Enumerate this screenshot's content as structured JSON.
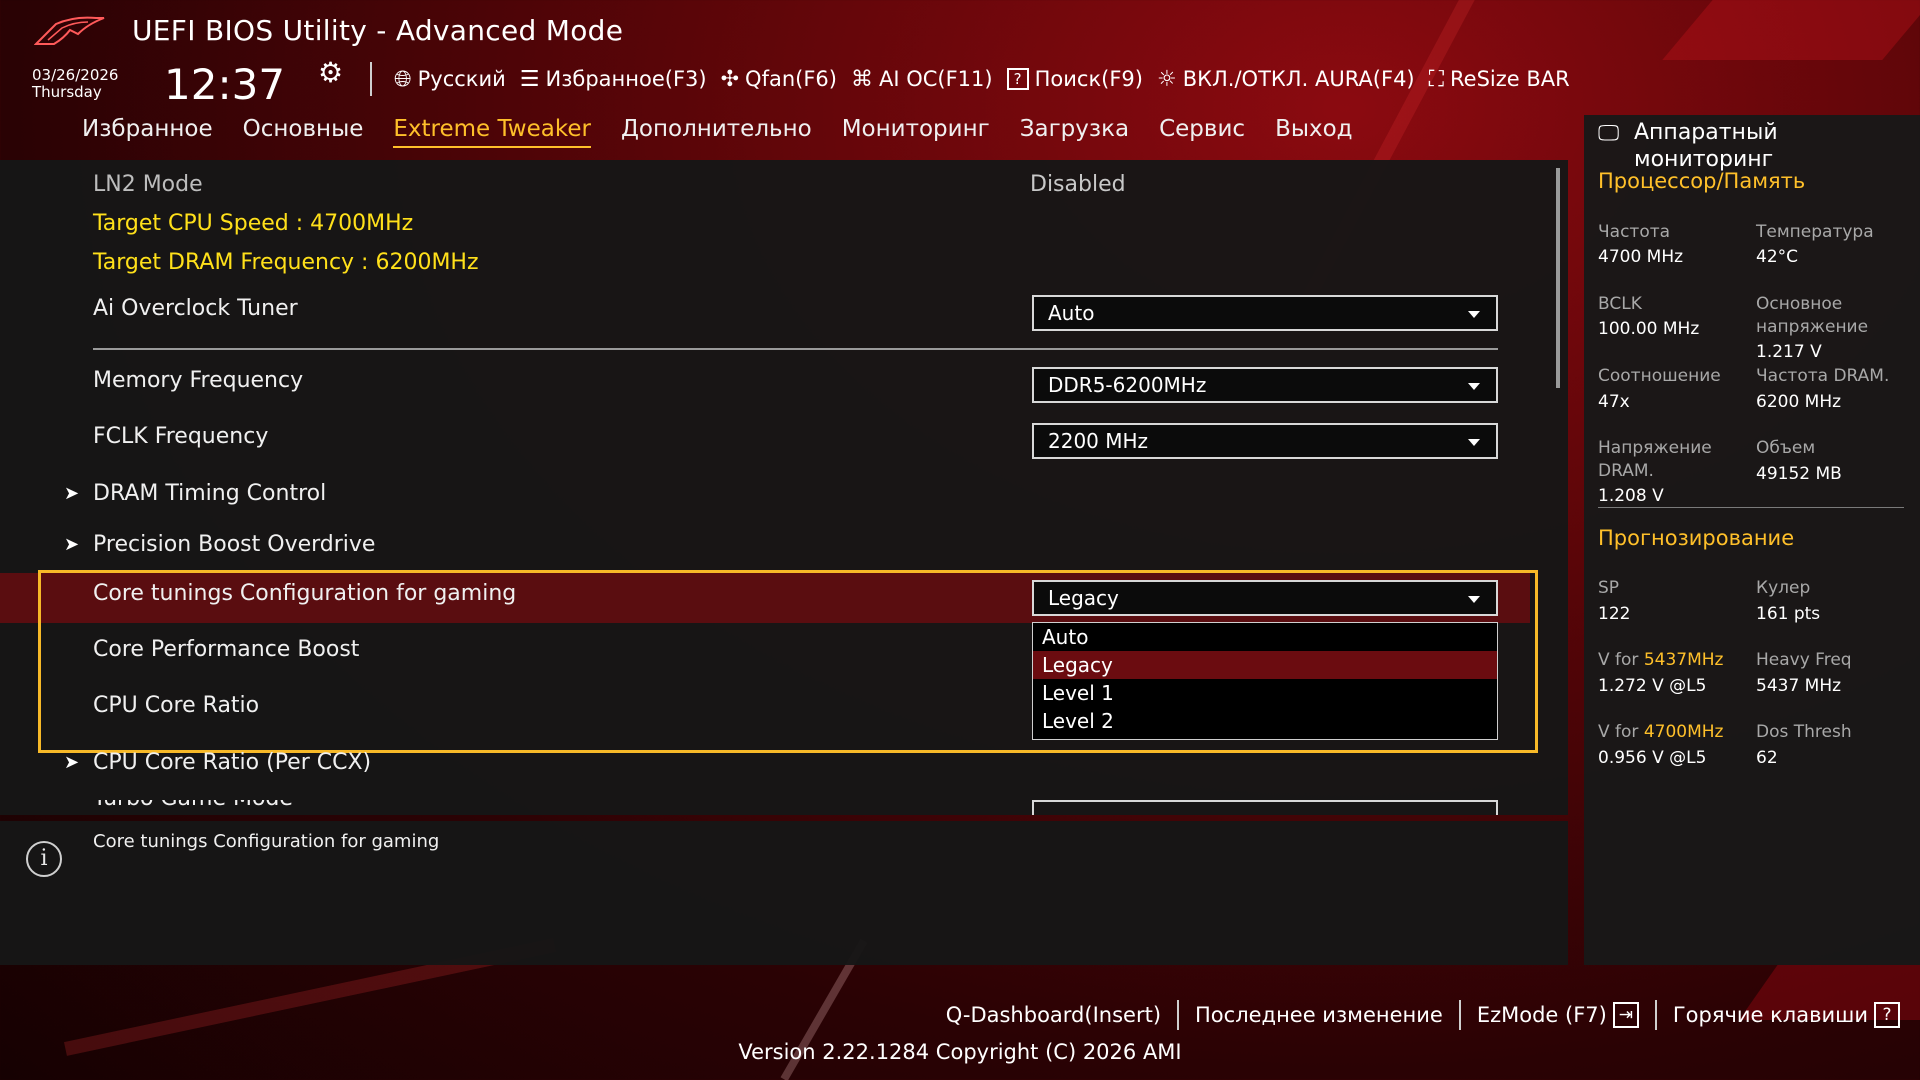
{
  "header": {
    "title": "UEFI BIOS Utility - Advanced Mode",
    "date": "03/26/2026",
    "weekday": "Thursday",
    "time": "12:37",
    "menu": [
      {
        "icon": "globe-icon",
        "label": "Русский"
      },
      {
        "icon": "favorites-list-icon",
        "label": "Избранное(F3)"
      },
      {
        "icon": "fan-icon",
        "label": "Qfan(F6)"
      },
      {
        "icon": "ai-chip-icon",
        "label": "AI OC(F11)"
      },
      {
        "icon": "help-box-icon",
        "label": "Поиск(F9)"
      },
      {
        "icon": "aura-light-icon",
        "label": "ВКЛ./ОТКЛ. AURA(F4)"
      },
      {
        "icon": "resize-bar-icon",
        "label": "ReSize BAR"
      }
    ]
  },
  "tabs": [
    "Избранное",
    "Основные",
    "Extreme Tweaker",
    "Дополнительно",
    "Мониторинг",
    "Загрузка",
    "Сервис",
    "Выход"
  ],
  "active_tab": "Extreme Tweaker",
  "settings": {
    "ln2_label": "LN2 Mode",
    "ln2_value": "Disabled",
    "target_cpu": "Target CPU Speed : 4700MHz",
    "target_dram": "Target DRAM Frequency : 6200MHz",
    "ai_tuner_label": "Ai Overclock Tuner",
    "ai_tuner_value": "Auto",
    "mem_freq_label": "Memory Frequency",
    "mem_freq_value": "DDR5-6200MHz",
    "fclk_label": "FCLK Frequency",
    "fclk_value": "2200 MHz",
    "dram_timing": "DRAM Timing Control",
    "pbo": "Precision Boost Overdrive",
    "core_tuning_label": "Core tunings Configuration for gaming",
    "core_tuning_value": "Legacy",
    "cpb_label": "Core Performance Boost",
    "core_ratio_label": "CPU Core Ratio",
    "core_ratio_ccx": "CPU Core Ratio (Per CCX)",
    "partial_label": "Turbo Game Mode"
  },
  "dropdown_options": [
    "Auto",
    "Legacy",
    "Level 1",
    "Level 2"
  ],
  "dropdown_selected": "Legacy",
  "help_text": "Core tunings Configuration for gaming",
  "monitor": {
    "title": "Аппаратный мониторинг",
    "section_cpu": "Процессор/Память",
    "freq_label": "Частота",
    "freq_value": "4700 MHz",
    "temp_label": "Температура",
    "temp_value": "42°C",
    "bclk_label": "BCLK",
    "bclk_value": "100.00 MHz",
    "vcore_label": "Основное напряжение",
    "vcore_value": "1.217 V",
    "ratio_label": "Соотношение",
    "ratio_value": "47x",
    "dram_freq_label": "Частота DRAM.",
    "dram_freq_value": "6200 MHz",
    "dram_volt_label": "Напряжение DRAM.",
    "dram_volt_value": "1.208 V",
    "capacity_label": "Объем",
    "capacity_value": "49152 MB",
    "section_pred": "Прогнозирование",
    "sp_label": "SP",
    "sp_value": "122",
    "cooler_label": "Кулер",
    "cooler_value": "161 pts",
    "vfor_prefix": "V for ",
    "vfor1_freq": "5437MHz",
    "vfor1_value": "1.272 V @L5",
    "heavy_label": "Heavy Freq",
    "heavy_value": "5437 MHz",
    "vfor2_freq": "4700MHz",
    "vfor2_value": "0.956 V @L5",
    "dos_label": "Dos Thresh",
    "dos_value": "62"
  },
  "footer": {
    "qdash": "Q-Dashboard(Insert)",
    "last_change": "Последнее изменение",
    "ezmode": "EzMode (F7)",
    "hotkeys": "Горячие клавиши",
    "version": "Version 2.22.1284 Copyright (C) 2026 AMI"
  },
  "colors": {
    "accent": "#ffc02a",
    "highlight_text": "#ffe01a",
    "selected_row": "#5a0d10",
    "frame": "#f7b928"
  }
}
